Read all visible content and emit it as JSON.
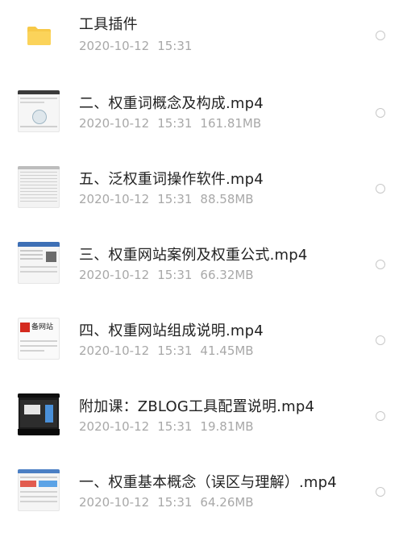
{
  "files": [
    {
      "title": "工具插件",
      "date": "2020-10-12",
      "time": "15:31",
      "size": "",
      "icon": "folder-icon"
    },
    {
      "title": "二、权重词概念及构成.mp4",
      "date": "2020-10-12",
      "time": "15:31",
      "size": "161.81MB",
      "icon": "video-thumbnail"
    },
    {
      "title": "五、泛权重词操作软件.mp4",
      "date": "2020-10-12",
      "time": "15:31",
      "size": "88.58MB",
      "icon": "video-thumbnail"
    },
    {
      "title": "三、权重网站案例及权重公式.mp4",
      "date": "2020-10-12",
      "time": "15:31",
      "size": "66.32MB",
      "icon": "video-thumbnail"
    },
    {
      "title": "四、权重网站组成说明.mp4",
      "date": "2020-10-12",
      "time": "15:31",
      "size": "41.45MB",
      "icon": "video-thumbnail"
    },
    {
      "title": "附加课：ZBLOG工具配置说明.mp4",
      "date": "2020-10-12",
      "time": "15:31",
      "size": "19.81MB",
      "icon": "video-thumbnail"
    },
    {
      "title": "一、权重基本概念（误区与理解）.mp4",
      "date": "2020-10-12",
      "time": "15:31",
      "size": "64.26MB",
      "icon": "video-thumbnail"
    }
  ],
  "thumbnail_text": {
    "row4": "备网站"
  },
  "colors": {
    "folder": "#f7c948",
    "title": "#222222",
    "meta": "#a8a8a8",
    "radio_border": "#c8c8c8"
  }
}
